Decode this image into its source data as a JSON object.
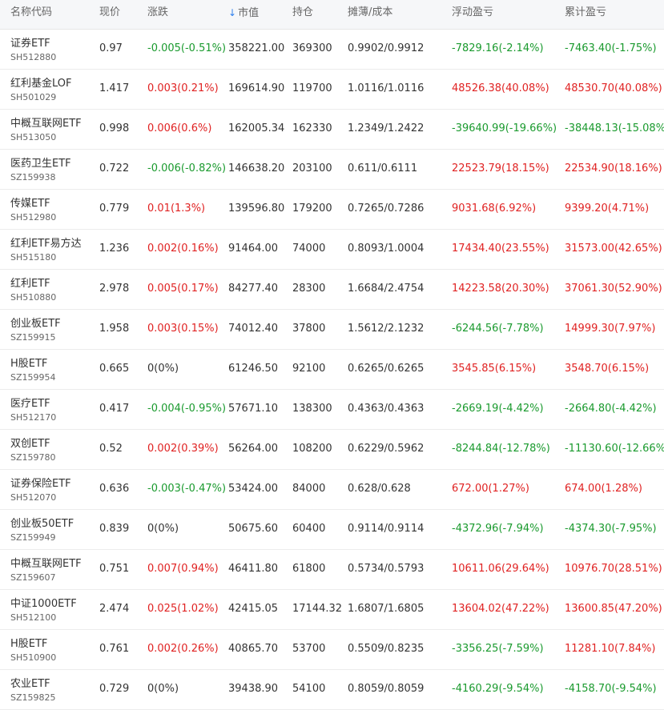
{
  "columns": [
    "名称代码",
    "现价",
    "涨跌",
    "市值",
    "持仓",
    "摊薄/成本",
    "浮动盈亏",
    "累计盈亏"
  ],
  "sort_arrow": "↓",
  "colors": {
    "up": "#e02222",
    "down": "#1a9a2e",
    "flat": "#333333",
    "accent": "#2f80ed"
  },
  "rows": [
    {
      "name": "证券ETF",
      "code": "SH512880",
      "price": "0.97",
      "change": "-0.005(-0.51%)",
      "change_dir": "down",
      "mv": "358221.00",
      "pos": "369300",
      "cost": "0.9902/0.9912",
      "float": "-7829.16(-2.14%)",
      "float_dir": "down",
      "cum": "-7463.40(-1.75%)",
      "cum_dir": "down"
    },
    {
      "name": "红利基金LOF",
      "code": "SH501029",
      "price": "1.417",
      "change": "0.003(0.21%)",
      "change_dir": "up",
      "mv": "169614.90",
      "pos": "119700",
      "cost": "1.0116/1.0116",
      "float": "48526.38(40.08%)",
      "float_dir": "up",
      "cum": "48530.70(40.08%)",
      "cum_dir": "up"
    },
    {
      "name": "中概互联网ETF",
      "code": "SH513050",
      "price": "0.998",
      "change": "0.006(0.6%)",
      "change_dir": "up",
      "mv": "162005.34",
      "pos": "162330",
      "cost": "1.2349/1.2422",
      "float": "-39640.99(-19.66%)",
      "float_dir": "down",
      "cum": "-38448.13(-15.08%)",
      "cum_dir": "down"
    },
    {
      "name": "医药卫生ETF",
      "code": "SZ159938",
      "price": "0.722",
      "change": "-0.006(-0.82%)",
      "change_dir": "down",
      "mv": "146638.20",
      "pos": "203100",
      "cost": "0.611/0.6111",
      "float": "22523.79(18.15%)",
      "float_dir": "up",
      "cum": "22534.90(18.16%)",
      "cum_dir": "up"
    },
    {
      "name": "传媒ETF",
      "code": "SH512980",
      "price": "0.779",
      "change": "0.01(1.3%)",
      "change_dir": "up",
      "mv": "139596.80",
      "pos": "179200",
      "cost": "0.7265/0.7286",
      "float": "9031.68(6.92%)",
      "float_dir": "up",
      "cum": "9399.20(4.71%)",
      "cum_dir": "up"
    },
    {
      "name": "红利ETF易方达",
      "code": "SH515180",
      "price": "1.236",
      "change": "0.002(0.16%)",
      "change_dir": "up",
      "mv": "91464.00",
      "pos": "74000",
      "cost": "0.8093/1.0004",
      "float": "17434.40(23.55%)",
      "float_dir": "up",
      "cum": "31573.00(42.65%)",
      "cum_dir": "up"
    },
    {
      "name": "红利ETF",
      "code": "SH510880",
      "price": "2.978",
      "change": "0.005(0.17%)",
      "change_dir": "up",
      "mv": "84277.40",
      "pos": "28300",
      "cost": "1.6684/2.4754",
      "float": "14223.58(20.30%)",
      "float_dir": "up",
      "cum": "37061.30(52.90%)",
      "cum_dir": "up"
    },
    {
      "name": "创业板ETF",
      "code": "SZ159915",
      "price": "1.958",
      "change": "0.003(0.15%)",
      "change_dir": "up",
      "mv": "74012.40",
      "pos": "37800",
      "cost": "1.5612/2.1232",
      "float": "-6244.56(-7.78%)",
      "float_dir": "down",
      "cum": "14999.30(7.97%)",
      "cum_dir": "up"
    },
    {
      "name": "H股ETF",
      "code": "SZ159954",
      "price": "0.665",
      "change": "0(0%)",
      "change_dir": "flat",
      "mv": "61246.50",
      "pos": "92100",
      "cost": "0.6265/0.6265",
      "float": "3545.85(6.15%)",
      "float_dir": "up",
      "cum": "3548.70(6.15%)",
      "cum_dir": "up"
    },
    {
      "name": "医疗ETF",
      "code": "SH512170",
      "price": "0.417",
      "change": "-0.004(-0.95%)",
      "change_dir": "down",
      "mv": "57671.10",
      "pos": "138300",
      "cost": "0.4363/0.4363",
      "float": "-2669.19(-4.42%)",
      "float_dir": "down",
      "cum": "-2664.80(-4.42%)",
      "cum_dir": "down"
    },
    {
      "name": "双创ETF",
      "code": "SZ159780",
      "price": "0.52",
      "change": "0.002(0.39%)",
      "change_dir": "up",
      "mv": "56264.00",
      "pos": "108200",
      "cost": "0.6229/0.5962",
      "float": "-8244.84(-12.78%)",
      "float_dir": "down",
      "cum": "-11130.60(-12.66%)",
      "cum_dir": "down"
    },
    {
      "name": "证券保险ETF",
      "code": "SH512070",
      "price": "0.636",
      "change": "-0.003(-0.47%)",
      "change_dir": "down",
      "mv": "53424.00",
      "pos": "84000",
      "cost": "0.628/0.628",
      "float": "672.00(1.27%)",
      "float_dir": "up",
      "cum": "674.00(1.28%)",
      "cum_dir": "up"
    },
    {
      "name": "创业板50ETF",
      "code": "SZ159949",
      "price": "0.839",
      "change": "0(0%)",
      "change_dir": "flat",
      "mv": "50675.60",
      "pos": "60400",
      "cost": "0.9114/0.9114",
      "float": "-4372.96(-7.94%)",
      "float_dir": "down",
      "cum": "-4374.30(-7.95%)",
      "cum_dir": "down"
    },
    {
      "name": "中概互联网ETF",
      "code": "SZ159607",
      "price": "0.751",
      "change": "0.007(0.94%)",
      "change_dir": "up",
      "mv": "46411.80",
      "pos": "61800",
      "cost": "0.5734/0.5793",
      "float": "10611.06(29.64%)",
      "float_dir": "up",
      "cum": "10976.70(28.51%)",
      "cum_dir": "up"
    },
    {
      "name": "中证1000ETF",
      "code": "SH512100",
      "price": "2.474",
      "change": "0.025(1.02%)",
      "change_dir": "up",
      "mv": "42415.05",
      "pos": "17144.32",
      "cost": "1.6807/1.6805",
      "float": "13604.02(47.22%)",
      "float_dir": "up",
      "cum": "13600.85(47.20%)",
      "cum_dir": "up"
    },
    {
      "name": "H股ETF",
      "code": "SH510900",
      "price": "0.761",
      "change": "0.002(0.26%)",
      "change_dir": "up",
      "mv": "40865.70",
      "pos": "53700",
      "cost": "0.5509/0.8235",
      "float": "-3356.25(-7.59%)",
      "float_dir": "down",
      "cum": "11281.10(7.84%)",
      "cum_dir": "up"
    },
    {
      "name": "农业ETF",
      "code": "SZ159825",
      "price": "0.729",
      "change": "0(0%)",
      "change_dir": "flat",
      "mv": "39438.90",
      "pos": "54100",
      "cost": "0.8059/0.8059",
      "float": "-4160.29(-9.54%)",
      "float_dir": "down",
      "cum": "-4158.70(-9.54%)",
      "cum_dir": "down"
    }
  ]
}
